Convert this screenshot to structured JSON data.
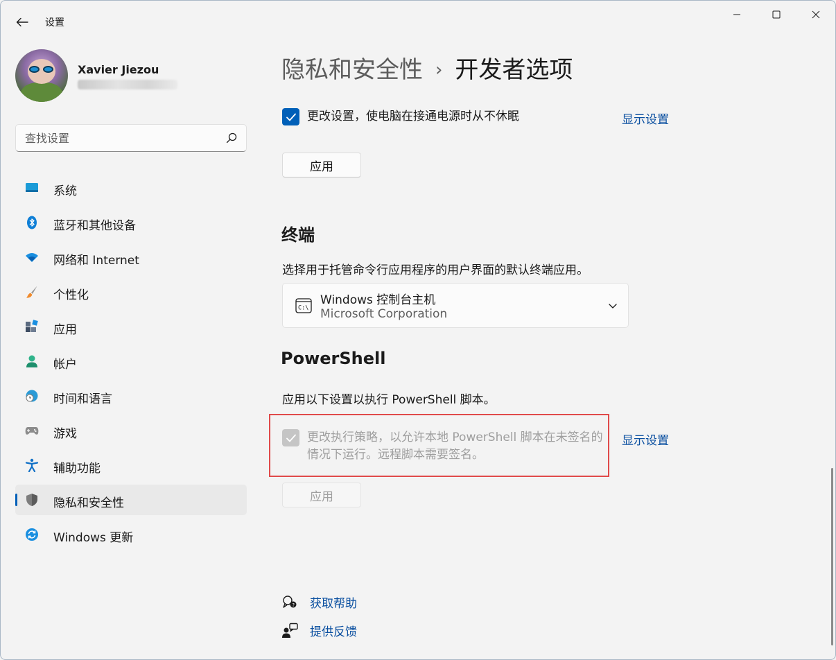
{
  "window": {
    "title": "设置"
  },
  "profile": {
    "name": "Xavier Jiezou"
  },
  "search": {
    "placeholder": "查找设置"
  },
  "nav": {
    "items": [
      {
        "label": "系统",
        "icon": "system-icon"
      },
      {
        "label": "蓝牙和其他设备",
        "icon": "bluetooth-icon"
      },
      {
        "label": "网络和 Internet",
        "icon": "wifi-icon"
      },
      {
        "label": "个性化",
        "icon": "brush-icon"
      },
      {
        "label": "应用",
        "icon": "apps-icon"
      },
      {
        "label": "帐户",
        "icon": "account-icon"
      },
      {
        "label": "时间和语言",
        "icon": "globe-clock-icon"
      },
      {
        "label": "游戏",
        "icon": "gamepad-icon"
      },
      {
        "label": "辅助功能",
        "icon": "accessibility-icon"
      },
      {
        "label": "隐私和安全性",
        "icon": "shield-icon",
        "selected": true
      },
      {
        "label": "Windows 更新",
        "icon": "update-icon"
      }
    ]
  },
  "page": {
    "breadcrumb_parent": "隐私和安全性",
    "breadcrumb_separator": "›",
    "title": "开发者选项"
  },
  "power": {
    "checkbox_label": "更改设置，使电脑在接通电源时从不休眠",
    "checked": true,
    "link": "显示设置",
    "apply": "应用"
  },
  "terminal": {
    "title": "终端",
    "description": "选择用于托管命令行应用程序的用户界面的默认终端应用。",
    "selected_title": "Windows 控制台主机",
    "selected_publisher": "Microsoft Corporation"
  },
  "powershell": {
    "title": "PowerShell",
    "description": "应用以下设置以执行 PowerShell 脚本。",
    "checkbox_line1": "更改执行策略，以允许本地 PowerShell 脚本在未签名的",
    "checkbox_line2": "情况下运行。远程脚本需要签名。",
    "checked": true,
    "disabled": true,
    "link": "显示设置",
    "apply": "应用"
  },
  "help": {
    "get_help": "获取帮助",
    "feedback": "提供反馈"
  },
  "colors": {
    "accent": "#005fb8",
    "link": "#0a4fa0",
    "highlight": "#e04a4a",
    "background": "#f3f3f3"
  }
}
